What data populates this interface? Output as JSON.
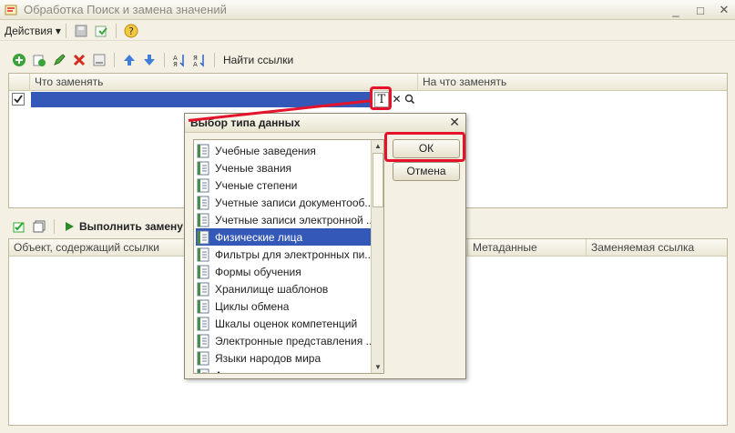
{
  "window": {
    "title": "Обработка  Поиск и замена значений"
  },
  "toolbar": {
    "actions_label": "Действия ▾",
    "find_links_label": "Найти ссылки"
  },
  "replace_grid": {
    "columns": [
      "Что заменять",
      "На что заменять"
    ],
    "edit_button_glyph": "T"
  },
  "lower": {
    "execute_label": "Выполнить замену с",
    "columns": [
      "Объект, содержащий ссылки",
      "Метаданные",
      "Заменяемая ссылка"
    ]
  },
  "dialog": {
    "title": "Выбор типа данных",
    "ok_label": "ОК",
    "cancel_label": "Отмена",
    "items": [
      "Учебные заведения",
      "Ученые звания",
      "Ученые степени",
      "Учетные записи документооб...",
      "Учетные записи электронной ...",
      "Физические лица",
      "Фильтры для электронных пи...",
      "Формы обучения",
      "Хранилище шаблонов",
      "Циклы обмена",
      "Шкалы оценок компетенций",
      "Электронные представления ...",
      "Языки народов мира",
      "Анкета электорального пункт..."
    ],
    "selected_index": 5
  },
  "colors": {
    "accent": "#3458b8",
    "highlight": "#e5122b"
  }
}
